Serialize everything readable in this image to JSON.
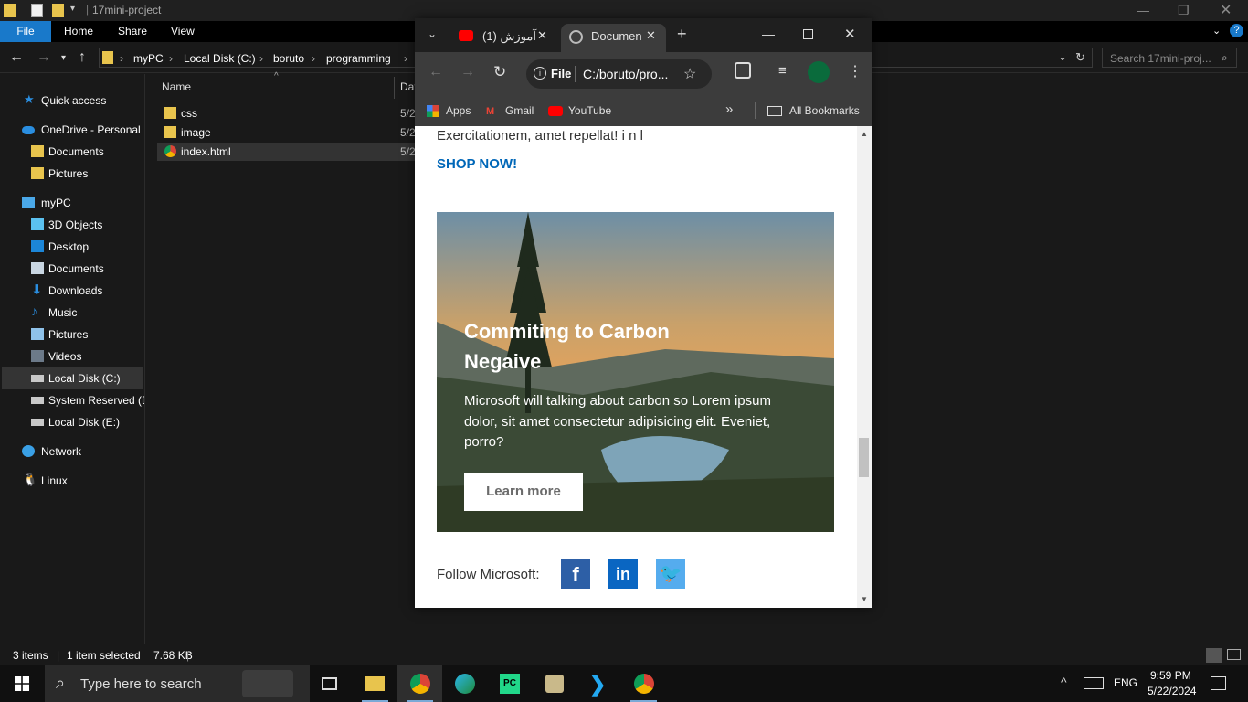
{
  "explorer": {
    "title": "17mini-project",
    "ribbon": {
      "file": "File",
      "home": "Home",
      "share": "Share",
      "view": "View"
    },
    "breadcrumb": [
      "myPC",
      "Local Disk (C:)",
      "boruto",
      "programming"
    ],
    "search_placeholder": "Search 17mini-proj...",
    "nav": {
      "quick_access": "Quick access",
      "onedrive": "OneDrive - Personal",
      "od_documents": "Documents",
      "od_pictures": "Pictures",
      "mypc": "myPC",
      "objects3d": "3D Objects",
      "desktop": "Desktop",
      "documents": "Documents",
      "downloads": "Downloads",
      "music": "Music",
      "pictures": "Pictures",
      "videos": "Videos",
      "local_c": "Local Disk (C:)",
      "system_reserved": "System Reserved (D",
      "local_e": "Local Disk (E:)",
      "network": "Network",
      "linux": "Linux"
    },
    "columns": {
      "name": "Name",
      "date": "Dat"
    },
    "files": [
      {
        "name": "css",
        "date": "5/2"
      },
      {
        "name": "image",
        "date": "5/2"
      },
      {
        "name": "index.html",
        "date": "5/2"
      }
    ],
    "status": {
      "items": "3 items",
      "selected": "1 item selected",
      "size": "7.68 KB"
    }
  },
  "chrome": {
    "tab1_title": "(1) آموزش",
    "tab2_title": "Documen",
    "omnibox_chip": "File",
    "omnibox_url": "C:/boruto/pro...",
    "bookmarks": {
      "apps": "Apps",
      "gmail": "Gmail",
      "youtube": "YouTube",
      "all": "All Bookmarks"
    }
  },
  "page": {
    "lead_text": "Exercitationem, amet repellat! i n l",
    "shop_link": "SHOP NOW!",
    "hero_title": "Commiting to Carbon Negaive",
    "hero_text": "Microsoft will talking about carbon so Lorem ipsum dolor, sit amet consectetur adipisicing elit. Eveniet, porro?",
    "learn_more": "Learn more",
    "follow_label": "Follow Microsoft:"
  },
  "taskbar": {
    "search_placeholder": "Type here to search",
    "lang": "ENG",
    "time": "9:59 PM",
    "date": "5/22/2024"
  },
  "colors": {
    "accent": "#1979ca",
    "link": "#0067b8",
    "facebook": "#2d5fa6",
    "linkedin": "#0a66c2",
    "twitter": "#55acee"
  }
}
